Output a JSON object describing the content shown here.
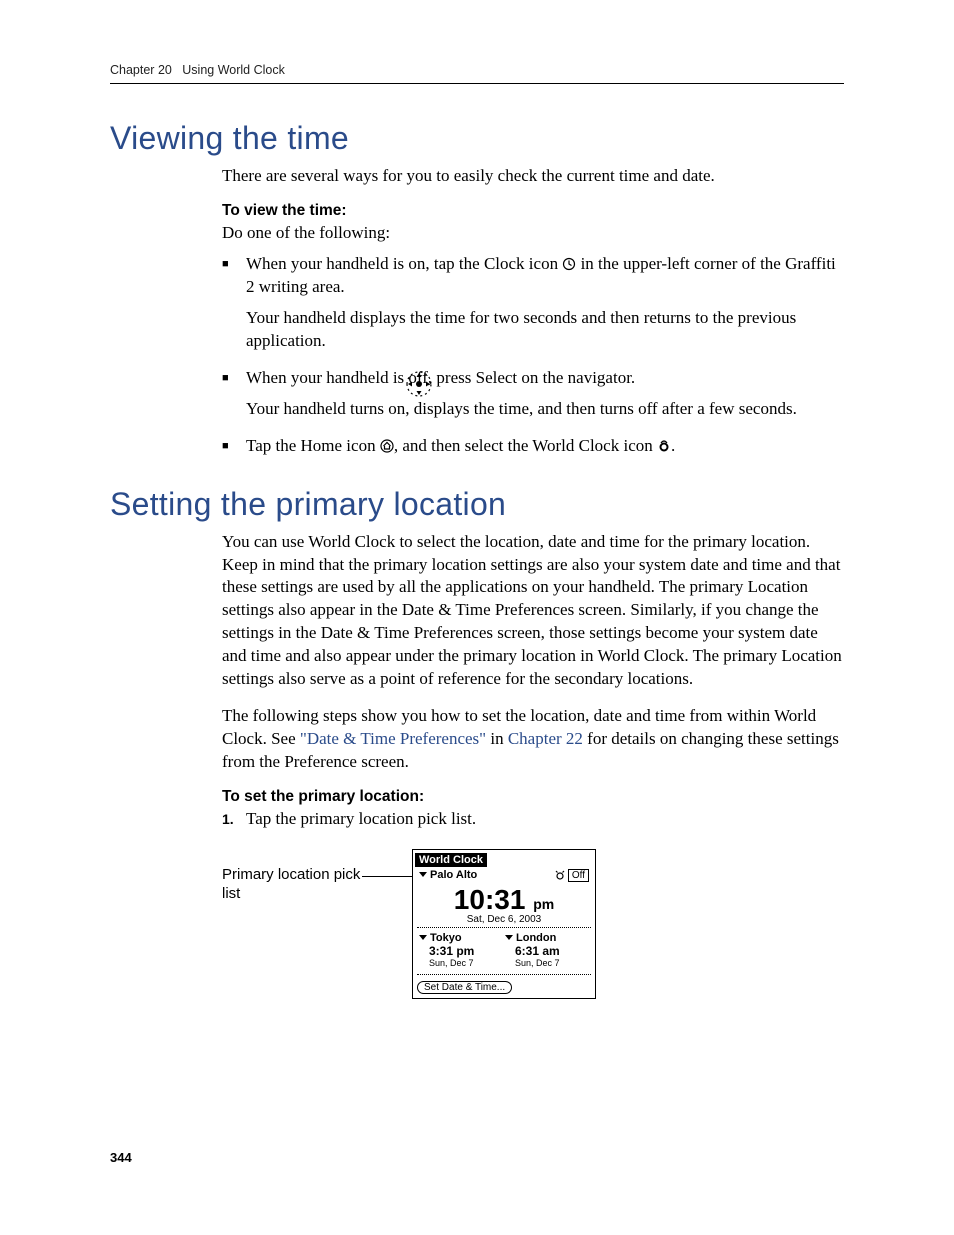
{
  "header": {
    "chapter": "Chapter 20",
    "title": "Using World Clock"
  },
  "section1": {
    "heading": "Viewing the time",
    "intro": "There are several ways for you to easily check the current time and date.",
    "procedure_head": "To view the time:",
    "lead": "Do one of the following:",
    "bullets": [
      {
        "pre": "When your handheld is on, tap the Clock icon ",
        "post": " in the upper-left corner of the Graffiti 2 writing area.",
        "sub": "Your handheld displays the time for two seconds and then returns to the previous application."
      },
      {
        "pre": "When your handheld is off, press Select on the navigator.",
        "post": "",
        "sub": "Your handheld turns on, displays the time, and then turns off after a few seconds."
      },
      {
        "pre": "Tap the Home icon ",
        "mid": ", and then select the World Clock icon ",
        "post": "."
      }
    ]
  },
  "section2": {
    "heading": "Setting the primary location",
    "para1": "You can use World Clock to select the location, date and time for the primary location. Keep in mind that the primary location settings are also your system date and time and that these settings are used by all the applications on your handheld. The primary Location settings also appear in the Date & Time Preferences screen. Similarly, if you change the settings in the Date & Time Preferences screen, those settings become your system date and time and also appear under the primary location in World Clock. The primary Location settings also serve as a point of reference for the secondary locations.",
    "para2_pre": "The following steps show you how to set the location, date and time from within World Clock. See ",
    "para2_link1": "\"Date & Time Preferences\"",
    "para2_mid": " in ",
    "para2_link2": "Chapter 22",
    "para2_post": " for details on changing these settings from the Preference screen.",
    "procedure_head": "To set the primary location:",
    "step1": "Tap the primary location pick list.",
    "callout": "Primary location pick list"
  },
  "device": {
    "title": "World Clock",
    "primary_city": "Palo Alto",
    "alarm_label": "Off",
    "big_time": "10:31",
    "big_ampm": "pm",
    "big_date": "Sat, Dec 6, 2003",
    "secondary": [
      {
        "city": "Tokyo",
        "time": "3:31 pm",
        "date": "Sun, Dec 7"
      },
      {
        "city": "London",
        "time": "6:31 am",
        "date": "Sun, Dec 7"
      }
    ],
    "button": "Set Date & Time..."
  },
  "page_number": "344"
}
